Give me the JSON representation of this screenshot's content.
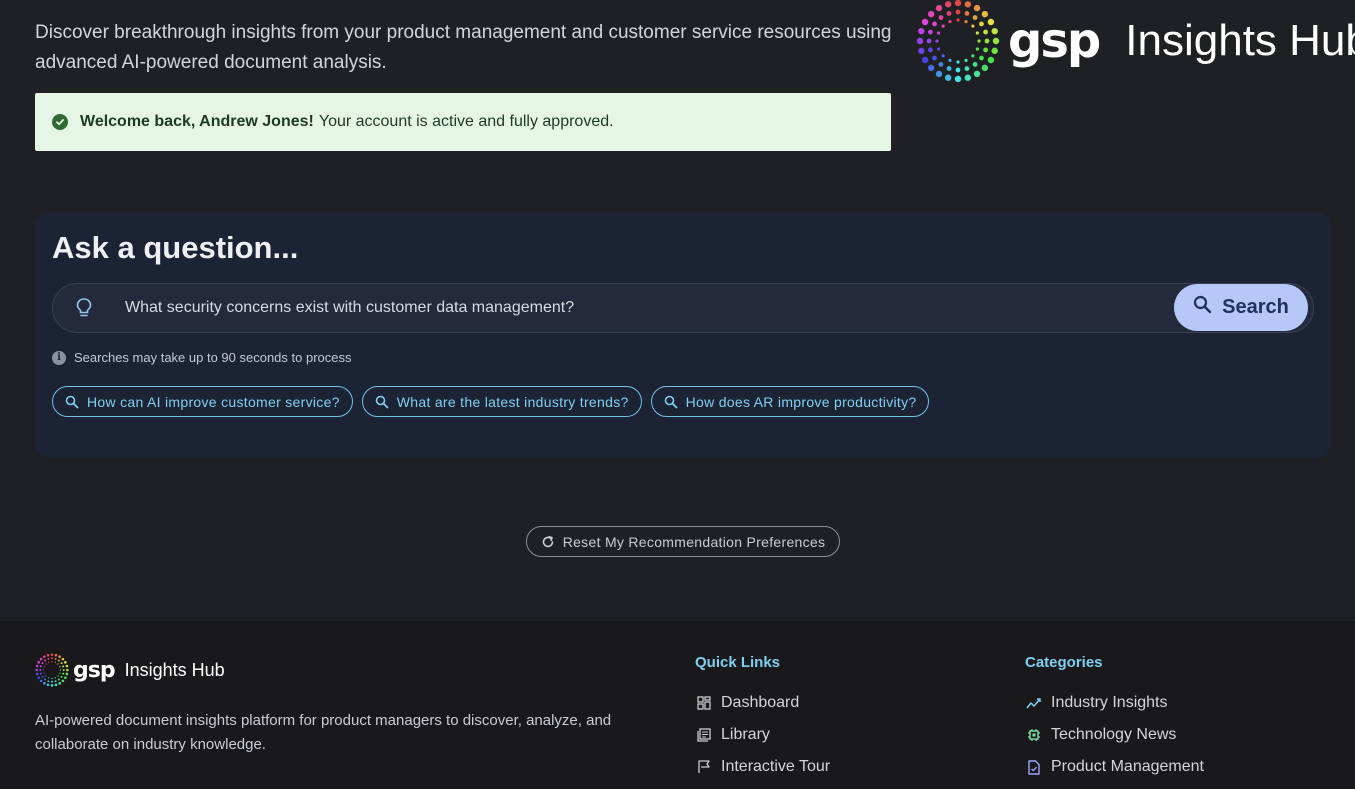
{
  "hero": {
    "description": "Discover breakthrough insights from your product management and customer service resources using advanced AI-powered document analysis."
  },
  "brand": {
    "logo_text": "gsp",
    "title": "Insights Hub"
  },
  "welcome": {
    "name_text": "Welcome back, Andrew Jones!",
    "message": "Your account is active and fully approved."
  },
  "ask": {
    "title": "Ask a question...",
    "query_value": "What security concerns exist with customer data management?",
    "search_label": "Search",
    "hint": "Searches may take up to 90 seconds to process",
    "suggestions": [
      "How can AI improve customer service?",
      "What are the latest industry trends?",
      "How does AR improve productivity?"
    ]
  },
  "reset_label": "Reset My Recommendation Preferences",
  "footer": {
    "logo_text": "gsp",
    "title": "Insights Hub",
    "description": "AI-powered document insights platform for product managers to discover, analyze, and collaborate on industry knowledge.",
    "quick_links": {
      "heading": "Quick Links",
      "items": [
        {
          "label": "Dashboard",
          "icon": "dashboard-icon"
        },
        {
          "label": "Library",
          "icon": "library-icon"
        },
        {
          "label": "Interactive Tour",
          "icon": "flag-icon"
        }
      ]
    },
    "categories": {
      "heading": "Categories",
      "items": [
        {
          "label": "Industry Insights",
          "icon": "trend-icon"
        },
        {
          "label": "Technology News",
          "icon": "chip-icon"
        },
        {
          "label": "Product Management",
          "icon": "document-icon"
        }
      ]
    }
  },
  "colors": {
    "background": "#1f2023",
    "card": "#1c2335",
    "accent": "#7fd0f0",
    "search_button": "#b5c8f7",
    "success_bg": "#e5f5e6"
  }
}
